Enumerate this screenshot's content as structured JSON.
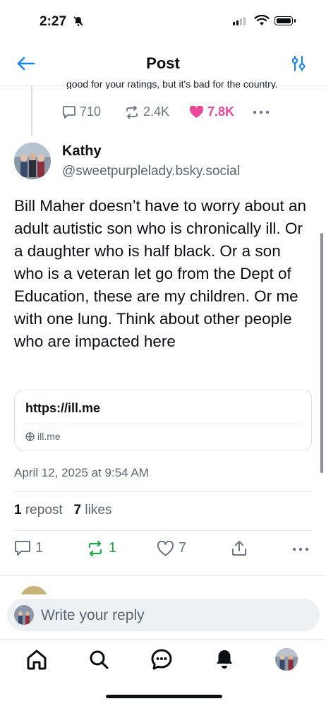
{
  "status_bar": {
    "time": "2:27"
  },
  "header": {
    "title": "Post"
  },
  "parent_post": {
    "truncated_text": "good for your ratings, but it's bad for the country.",
    "replies": "710",
    "reposts": "2.4K",
    "likes": "7.8K"
  },
  "post": {
    "author_name": "Kathy",
    "author_handle": "@sweetpurplelady.bsky.social",
    "text": "Bill Maher doesn’t have to worry about an adult autistic son who is chronically ill. Or a daughter who is half black. Or a son who is a veteran let go from the Dept of Education, these are my children. Or me with one lung. Think about other people who are impacted here",
    "link_url": "https://ill.me",
    "link_domain": "ill.me",
    "date": "April 12, 2025 at 9:54 AM",
    "repost_count": "1",
    "repost_label": "repost",
    "like_count": "7",
    "like_label": "likes",
    "actions": {
      "replies": "1",
      "reposts": "1",
      "likes": "7"
    }
  },
  "reply_box": {
    "placeholder": "Write your reply"
  },
  "colors": {
    "accent": "#1083fe",
    "like_pink": "#ec4899",
    "repost_green": "#1ca74a",
    "muted": "#5a6673"
  }
}
